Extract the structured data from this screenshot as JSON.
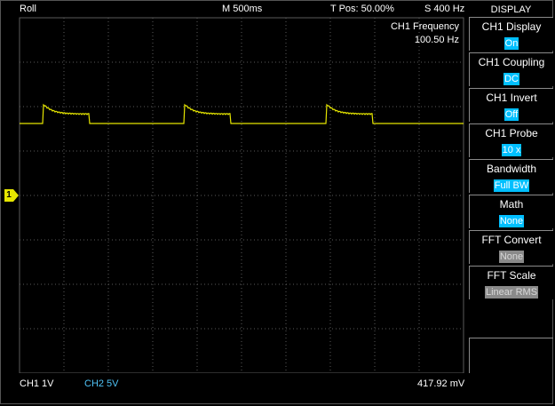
{
  "header": {
    "mode": "Roll",
    "timebase": "M 500ms",
    "trigger_pos": "T Pos: 50.00%",
    "sample_rate": "S 400 Hz"
  },
  "menu": {
    "title": "DISPLAY",
    "items": [
      {
        "label": "CH1 Display",
        "value": "On",
        "active": true
      },
      {
        "label": "CH1 Coupling",
        "value": "DC",
        "active": true
      },
      {
        "label": "CH1 Invert",
        "value": "Off",
        "active": true
      },
      {
        "label": "CH1 Probe",
        "value": "10 x",
        "active": true
      },
      {
        "label": "Bandwidth",
        "value": "Full BW",
        "active": true
      },
      {
        "label": "Math",
        "value": "None",
        "active": true
      },
      {
        "label": "FFT Convert",
        "value": "None",
        "active": false
      },
      {
        "label": "FFT Scale",
        "value": "Linear RMS",
        "active": false
      }
    ]
  },
  "measurement": {
    "label": "CH1 Frequency",
    "value": "100.50 Hz"
  },
  "status": {
    "ch1": "CH1  1V",
    "ch2": "CH2  5V",
    "cursor_value": "417.92 mV"
  },
  "channel_marker": "1",
  "colors": {
    "trace": "#e6e600",
    "grid": "#5a5a5a",
    "ch2": "#4fc3f7",
    "menu_highlight": "#00bfff"
  }
}
